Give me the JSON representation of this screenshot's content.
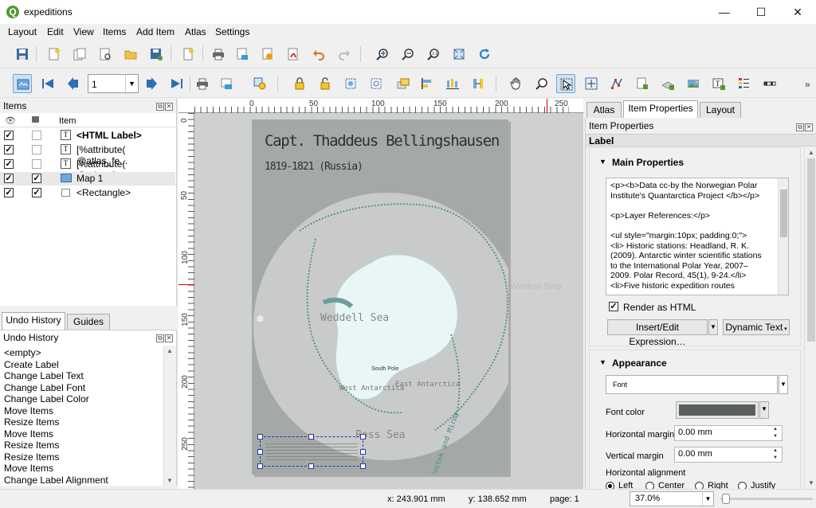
{
  "window": {
    "title": "expeditions",
    "minimize": "—",
    "maximize": "☐",
    "close": "✕"
  },
  "menu": [
    "Layout",
    "Edit",
    "View",
    "Items",
    "Add Item",
    "Atlas",
    "Settings"
  ],
  "toolbar2": {
    "page_value": "1"
  },
  "items_panel": {
    "title": "Items",
    "col_item": "Item",
    "rows": [
      {
        "label": "<HTML Label>",
        "visible": true,
        "locked": false,
        "bold": true,
        "icon": "label-icon"
      },
      {
        "label": "[%attribute( @atlas_fe...",
        "visible": true,
        "locked": false,
        "bold": false,
        "icon": "label-icon"
      },
      {
        "label": "[%attribute( @atlas_fe...",
        "visible": true,
        "locked": false,
        "bold": false,
        "icon": "label-icon"
      },
      {
        "label": "Map 1",
        "visible": true,
        "locked": true,
        "bold": false,
        "icon": "map-icon"
      },
      {
        "label": "<Rectangle>",
        "visible": true,
        "locked": true,
        "bold": false,
        "icon": "rectangle-icon"
      }
    ]
  },
  "bottom_tabs": {
    "undo": "Undo History",
    "guides": "Guides"
  },
  "undo_panel": {
    "title": "Undo History",
    "items": [
      "<empty>",
      "Create Label",
      "Change Label Text",
      "Change Label Font",
      "Change Label Color",
      "Move Items",
      "Resize Items",
      "Move Items",
      "Resize Items",
      "Resize Items",
      "Move Items",
      "Change Label Alignment"
    ]
  },
  "canvas": {
    "ruler_h": [
      "0",
      "50",
      "100",
      "150",
      "200",
      "250"
    ],
    "ruler_v": [
      "0",
      "50",
      "100",
      "150",
      "200",
      "250"
    ],
    "map_title": "Capt. Thaddeus Bellingshausen",
    "map_subtitle": "1819-1821 (Russia)",
    "map_labels": {
      "weddell": "Weddell Sea",
      "ross": "Ross Sea",
      "west": "West Antarctica",
      "east": "East Antarctica",
      "pole": "South Pole",
      "route": "Vostok and Mirny"
    },
    "watermark": "Window Snip"
  },
  "right_tabs": {
    "atlas": "Atlas",
    "item_props": "Item Properties",
    "layout": "Layout"
  },
  "props": {
    "title": "Item Properties",
    "section": "Label",
    "main_props": "Main Properties",
    "html_lines": [
      "<p><b>Data cc-by the Norwegian Polar",
      "Institute's Quantarctica Project </b></p>",
      "",
      "<p>Layer References:</p>",
      "",
      "<ul style=\"margin:10px; padding:0;\">",
      "<li> Historic stations: Headland, R. K.",
      "(2009). Antarctic winter scientific stations",
      "to the International Polar Year, 2007–",
      "2009. Polar Record, 45(1), 9-24.</li>",
      "<li>Five historic expedition routes"
    ],
    "render_html": "Render as HTML",
    "insert_btn": "Insert/Edit Expression…",
    "dynamic_btn": "Dynamic Text",
    "appearance": "Appearance",
    "font_btn": "Font",
    "font_color_lbl": "Font color",
    "font_color": "#585f5c",
    "hmargin_lbl": "Horizontal margin",
    "hmargin": "0.00 mm",
    "vmargin_lbl": "Vertical margin",
    "vmargin": "0.00 mm",
    "halign_lbl": "Horizontal alignment",
    "align_opts": [
      "Left",
      "Center",
      "Right",
      "Justify"
    ]
  },
  "status": {
    "x": "x: 243.901 mm",
    "y": "y: 138.652 mm",
    "page": "page: 1",
    "zoom": "37.0%"
  }
}
